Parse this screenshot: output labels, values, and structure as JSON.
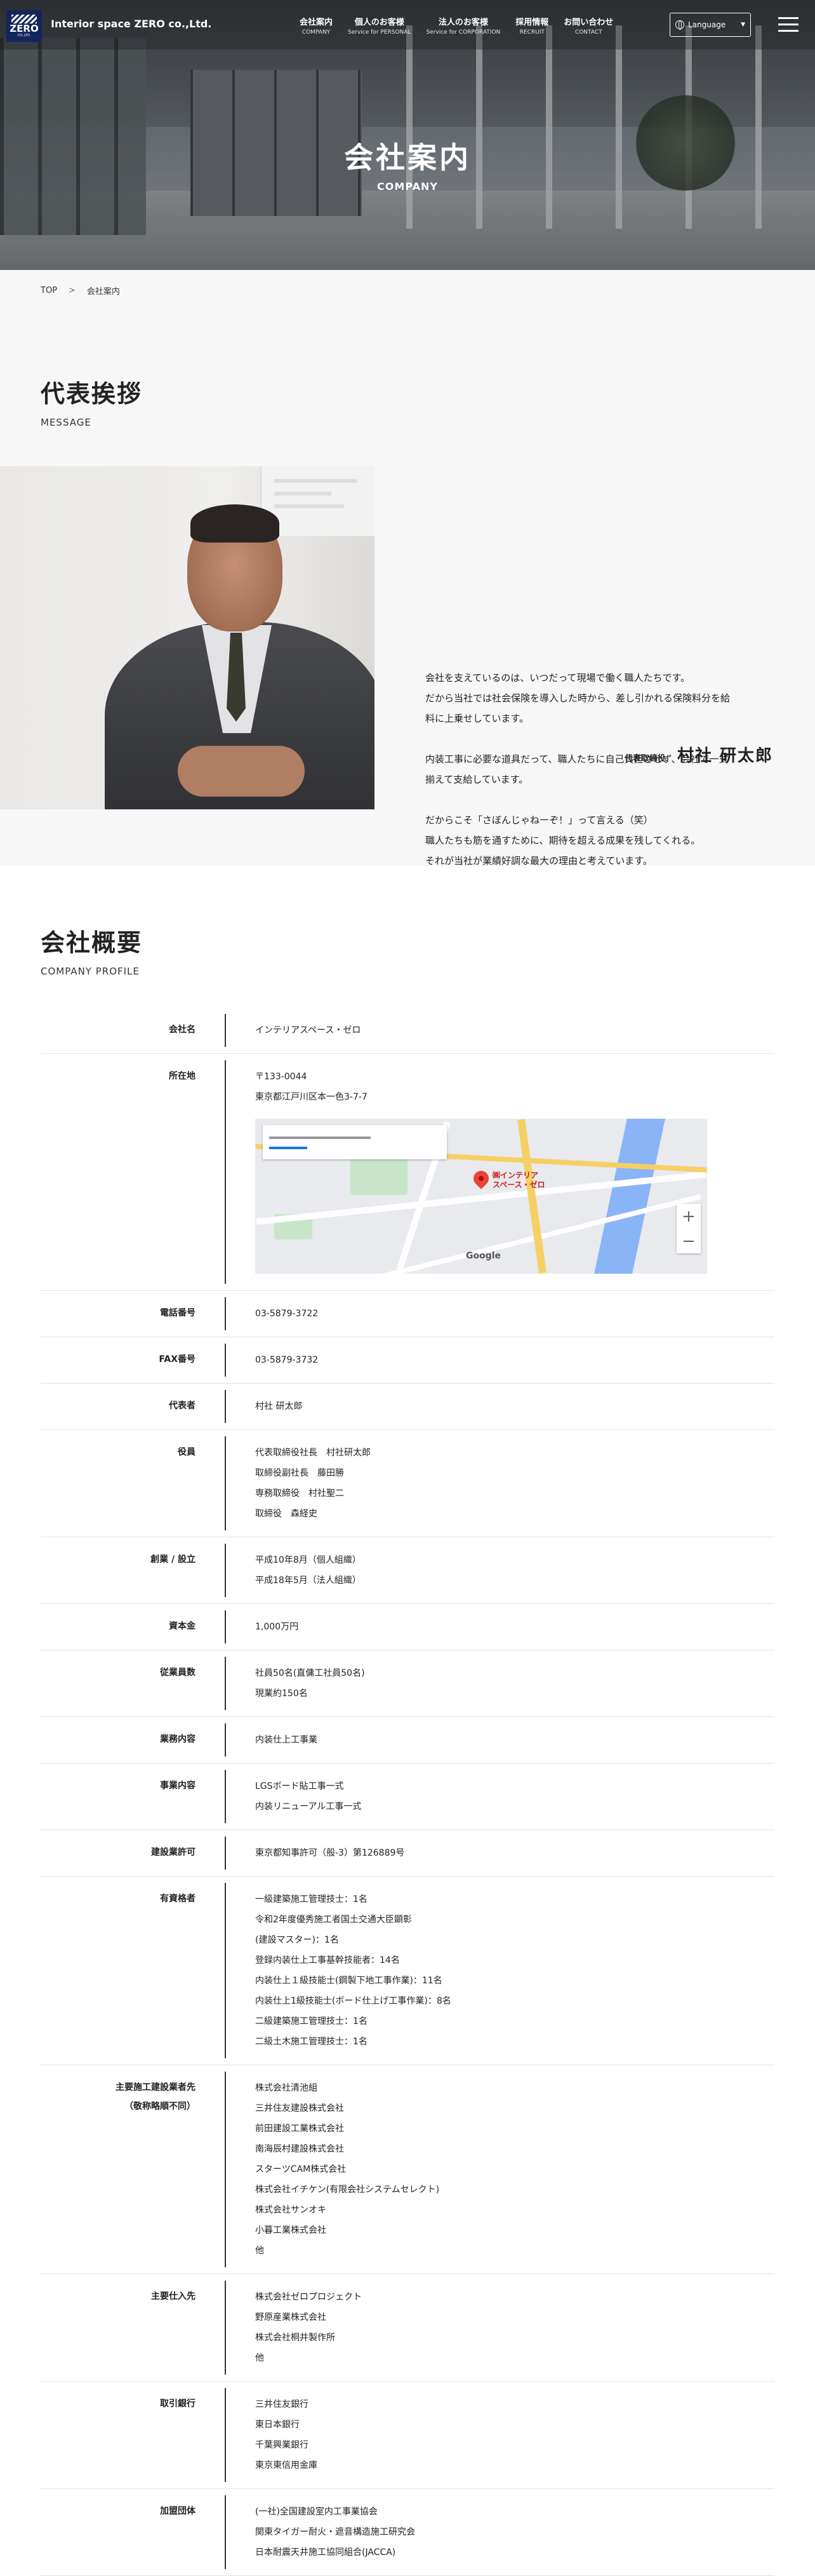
{
  "header": {
    "logo_word": "ZERO",
    "logo_sub": "CO.,LTD.",
    "company_name": "Interior space ZERO co.,Ltd.",
    "nav": [
      {
        "jp": "会社案内",
        "en": "COMPANY"
      },
      {
        "jp": "個人のお客様",
        "en": "Service for PERSONAL"
      },
      {
        "jp": "法人のお客様",
        "en": "Service for CORPORATION"
      },
      {
        "jp": "採用情報",
        "en": "RECRUIT"
      },
      {
        "jp": "お問い合わせ",
        "en": "CONTACT"
      }
    ],
    "language_label": "Language"
  },
  "hero": {
    "title": "会社案内",
    "subtitle": "COMPANY"
  },
  "breadcrumb": {
    "top": "TOP",
    "sep": ">",
    "current": "会社案内"
  },
  "message": {
    "title": "代表挨拶",
    "title_en": "MESSAGE",
    "paragraphs": [
      [
        "会社を支えているのは、いつだって現場で働く職人たちです。",
        "だから当社では社会保険を導入した時から、差し引かれる保険料分を給",
        "料に上乗せしています。"
      ],
      [
        "内装工事に必要な道具だって、職人たちに自己負担させず、会社で一式",
        "揃えて支給しています。"
      ],
      [
        "だからこそ「さぼんじゃねーぞ！」って言える（笑）",
        "職人たちも筋を通すために、期待を超える成果を残してくれる。",
        "それが当社が業績好調な最大の理由と考えています。"
      ]
    ],
    "sign_role": "代表取締役",
    "sign_name": "村社 研太郎"
  },
  "profile": {
    "title": "会社概要",
    "title_en": "COMPANY PROFILE",
    "map": {
      "label_line1": "㈱インテリア",
      "label_line2": "スペース・ゼロ",
      "zoom_in": "+",
      "zoom_out": "−",
      "google": "Google"
    },
    "rows": [
      {
        "label": [
          "会社名"
        ],
        "lines": [
          "インテリアスペース・ゼロ"
        ]
      },
      {
        "label": [
          "所在地"
        ],
        "lines": [
          "〒133-0044",
          "東京都江戸川区本一色3-7-7"
        ],
        "map": true
      },
      {
        "label": [
          "電話番号"
        ],
        "lines": [
          "03-5879-3722"
        ]
      },
      {
        "label": [
          "FAX番号"
        ],
        "lines": [
          "03-5879-3732"
        ]
      },
      {
        "label": [
          "代表者"
        ],
        "lines": [
          "村社 研太郎"
        ]
      },
      {
        "label": [
          "役員"
        ],
        "lines": [
          "代表取締役社長　村社研太郎",
          "取締役副社長　藤田勝",
          "専務取締役　村社聖二",
          "取締役　森経史"
        ]
      },
      {
        "label": [
          "創業 / 設立"
        ],
        "lines": [
          "平成10年8月（個人組織）",
          "平成18年5月（法人組織）"
        ]
      },
      {
        "label": [
          "資本金"
        ],
        "lines": [
          "1,000万円"
        ]
      },
      {
        "label": [
          "従業員数"
        ],
        "lines": [
          "社員50名(直傭工社員50名)",
          "現業約150名"
        ]
      },
      {
        "label": [
          "業務内容"
        ],
        "lines": [
          "内装仕上工事業"
        ]
      },
      {
        "label": [
          "事業内容"
        ],
        "lines": [
          "LGSボード貼工事一式",
          "内装リニューアル工事一式"
        ]
      },
      {
        "label": [
          "建設業許可"
        ],
        "lines": [
          "東京都知事許可（般-3）第126889号"
        ]
      },
      {
        "label": [
          "有資格者"
        ],
        "lines": [
          "一級建築施工管理技士：1名",
          "令和2年度優秀施工者国土交通大臣顕彰",
          "(建設マスター)：1名",
          "登録内装仕上工事基幹技能者：14名",
          "内装仕上１級技能士(鋼製下地工事作業)：11名",
          "内装仕上1級技能士(ボード仕上げ工事作業)：8名",
          "二級建築施工管理技士：1名",
          "二級土木施工管理技士：1名"
        ]
      },
      {
        "label": [
          "主要施工建設業者先",
          "（敬称略順不同）"
        ],
        "lines": [
          "株式会社清池組",
          "三井住友建設株式会社",
          "前田建設工業株式会社",
          "南海辰村建設株式会社",
          "スターツCAM株式会社",
          "株式会社イチケン(有限会社システムセレクト)",
          "株式会社サンオキ",
          "小暮工業株式会社",
          "他"
        ]
      },
      {
        "label": [
          "主要仕入先"
        ],
        "lines": [
          "株式会社ゼロプロジェクト",
          "野原産業株式会社",
          "株式会社桐井製作所",
          "他"
        ]
      },
      {
        "label": [
          "取引銀行"
        ],
        "lines": [
          "三井住友銀行",
          "東日本銀行",
          "千葉興業銀行",
          "東京東信用金庫"
        ]
      },
      {
        "label": [
          "加盟団体"
        ],
        "lines": [
          "(一社)全国建設室内工事業協会",
          "関東タイガー耐火・遮音構造施工研究会",
          "日本耐震天井施工協同組合(JACCA)"
        ]
      }
    ]
  }
}
